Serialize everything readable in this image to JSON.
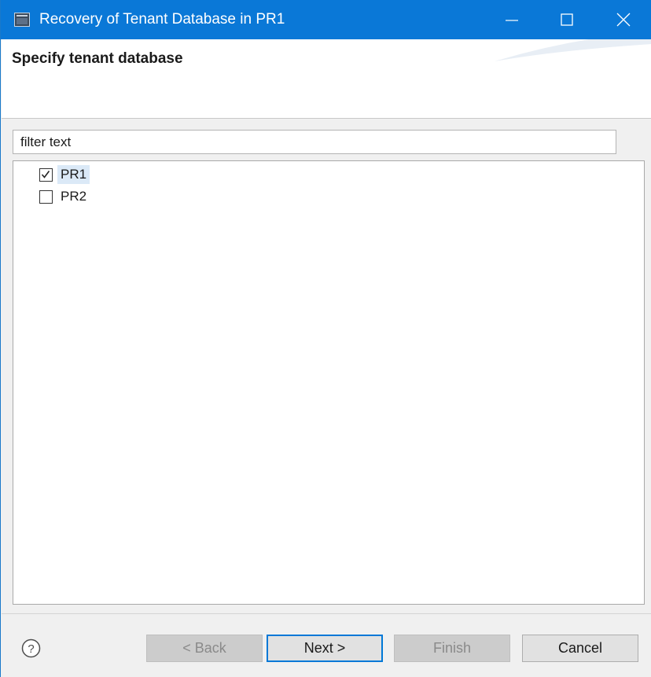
{
  "window": {
    "title": "Recovery of Tenant Database in PR1",
    "title_icon": "app-window-icon",
    "controls": {
      "minimize_icon": "minimize-icon",
      "maximize_icon": "maximize-icon",
      "close_icon": "close-icon"
    },
    "titlebar_color": "#0a78d7"
  },
  "header": {
    "title": "Specify tenant database"
  },
  "filter": {
    "placeholder": "filter text",
    "value": ""
  },
  "tenants": [
    {
      "label": "PR1",
      "checked": true,
      "selected": true
    },
    {
      "label": "PR2",
      "checked": false,
      "selected": false
    }
  ],
  "footer": {
    "help_icon": "help-icon",
    "back_label": "< Back",
    "next_label": "Next >",
    "finish_label": "Finish",
    "cancel_label": "Cancel",
    "back_enabled": false,
    "finish_enabled": false,
    "accent_color": "#0078d7"
  }
}
